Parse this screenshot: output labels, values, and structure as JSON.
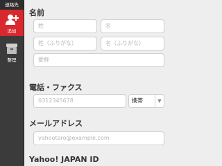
{
  "sidebar": {
    "header": "連絡先",
    "items": [
      {
        "label": "追加",
        "icon": "add-user-icon",
        "active": true
      },
      {
        "label": "整理",
        "icon": "archive-box-icon",
        "active": false
      }
    ]
  },
  "sections": {
    "name": {
      "title": "名前",
      "last_name_placeholder": "姓",
      "first_name_placeholder": "名",
      "last_kana_placeholder": "姓（ふりがな）",
      "first_kana_placeholder": "名（ふりがな）",
      "nickname_placeholder": "愛称"
    },
    "phone": {
      "title": "電話・ファクス",
      "number_placeholder": "0312345678",
      "type_value": "携帯"
    },
    "email": {
      "title": "メールアドレス",
      "placeholder": "yahootaro@example.com"
    },
    "yahoo_id": {
      "title": "Yahoo! JAPAN ID"
    }
  },
  "colors": {
    "accent": "#d9272e",
    "sidebar_bg": "#3b3b3b"
  }
}
